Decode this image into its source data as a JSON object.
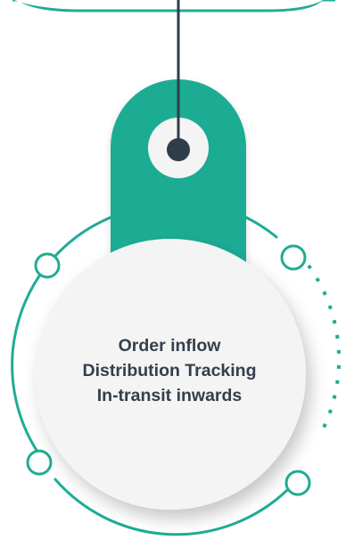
{
  "card": {
    "lines": [
      "Order inflow",
      "Distribution Tracking",
      "In-transit inwards"
    ]
  },
  "colors": {
    "accent": "#1fac94",
    "dark": "#2f3d4b",
    "text": "#333f4c",
    "disc": "#f4f4f4",
    "background": "#ffffff"
  },
  "icons": {
    "tag": "tag-shape-icon",
    "hole": "tag-hole-icon",
    "string": "hanging-string-icon",
    "nodes": "ring-node-icon"
  }
}
